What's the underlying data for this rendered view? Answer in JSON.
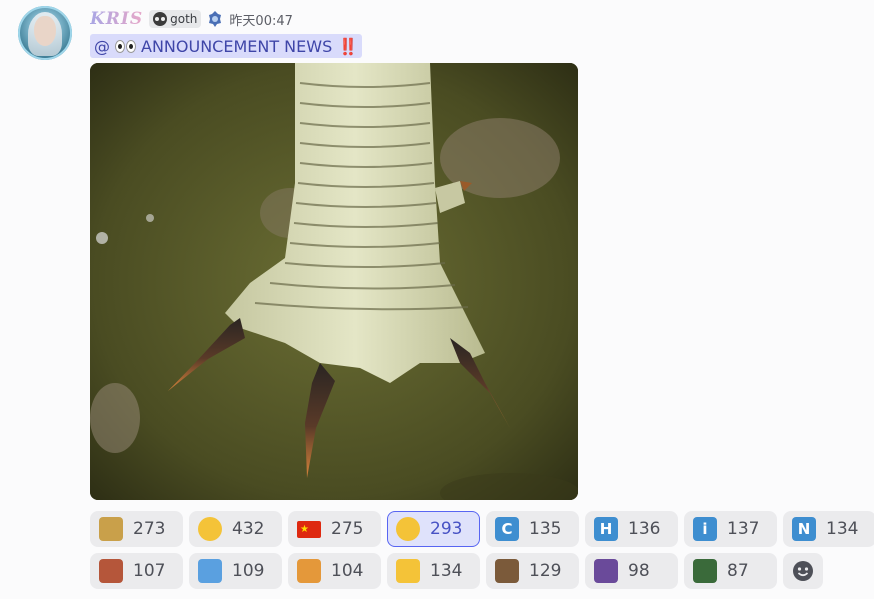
{
  "message": {
    "username": "KRIS",
    "tag": "goth",
    "timestamp": "昨天00:47",
    "content": {
      "mention": "@",
      "text": "ANNOUNCEMENT NEWS",
      "emphasis": "‼️"
    },
    "attachment": {
      "icon": "image-attachment"
    }
  },
  "reactions": [
    {
      "icon": "bird-emoji",
      "count": "273",
      "color": "#c9a04a"
    },
    {
      "icon": "heart-eyes-emoji",
      "count": "432",
      "color": "#f4c338"
    },
    {
      "icon": "china-flag-emoji",
      "count": "275",
      "color": "#de2910"
    },
    {
      "icon": "thinking-face-emoji",
      "count": "293",
      "color": "#f4c338",
      "active": true
    },
    {
      "icon": "letter-c-emoji",
      "letter": "C",
      "count": "135",
      "color": "#3e8ed0"
    },
    {
      "icon": "letter-h-emoji",
      "letter": "H",
      "count": "136",
      "color": "#3e8ed0"
    },
    {
      "icon": "letter-i-emoji",
      "letter": "i",
      "count": "137",
      "color": "#3e8ed0"
    },
    {
      "icon": "letter-n-emoji",
      "letter": "N",
      "count": "134",
      "color": "#3e8ed0"
    },
    {
      "icon": "boot-emoji",
      "count": "107",
      "color": "#b5563a"
    },
    {
      "icon": "shark-emoji",
      "count": "109",
      "color": "#5aa0e0"
    },
    {
      "icon": "angry-cat-emoji",
      "count": "104",
      "color": "#e4983a"
    },
    {
      "icon": "leg-emoji",
      "count": "134",
      "color": "#f4c338"
    },
    {
      "icon": "frog-emoji",
      "count": "129",
      "color": "#7b5a3a"
    },
    {
      "icon": "cat-party-emoji",
      "count": "98",
      "color": "#6a4a9a"
    },
    {
      "icon": "lizard-emoji",
      "count": "87",
      "color": "#3a6a3a"
    }
  ],
  "add_reaction": {
    "icon": "add-reaction-icon"
  }
}
